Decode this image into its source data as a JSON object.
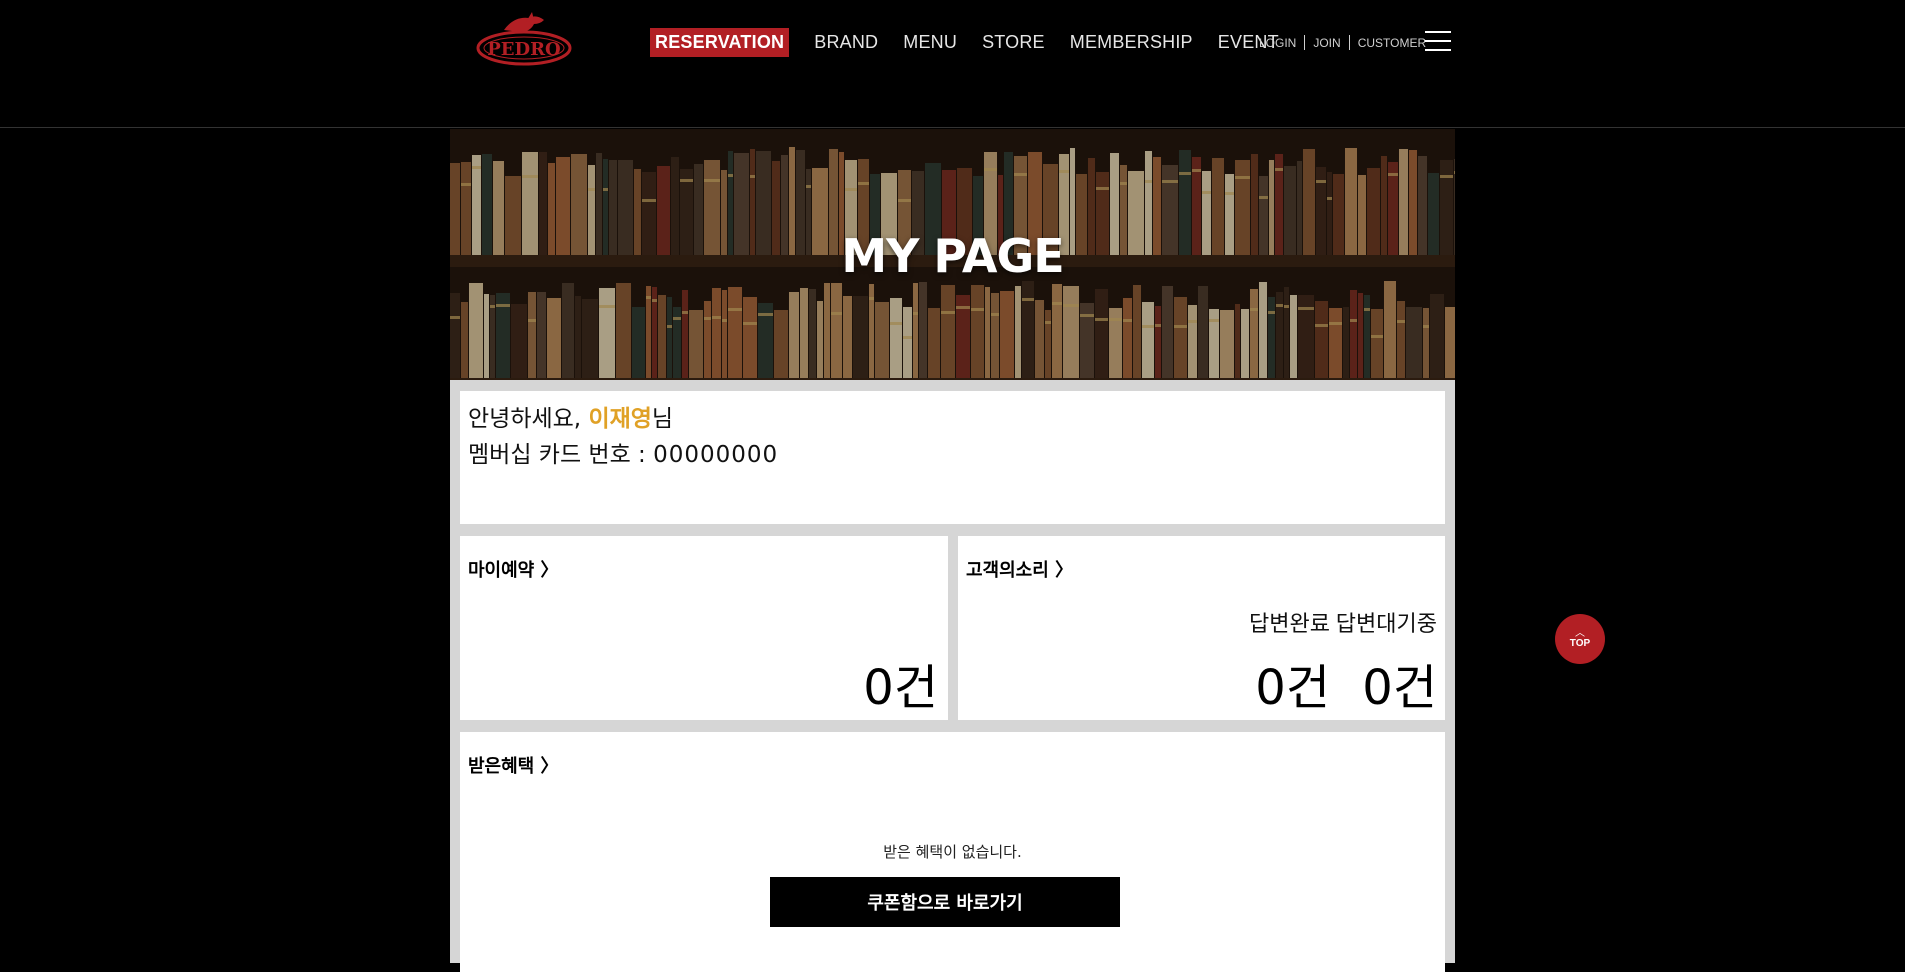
{
  "header": {
    "logo_text": "PEDRO",
    "nav": [
      {
        "label": "RESERVATION",
        "active": true
      },
      {
        "label": "BRAND",
        "active": false
      },
      {
        "label": "MENU",
        "active": false
      },
      {
        "label": "STORE",
        "active": false
      },
      {
        "label": "MEMBERSHIP",
        "active": false
      },
      {
        "label": "EVENT",
        "active": false
      }
    ],
    "util": {
      "login": "LOGIN",
      "join": "JOIN",
      "customer": "CUSTOMER"
    },
    "menu_icon": "hamburger-menu-icon",
    "accent_color": "#b21f24"
  },
  "banner": {
    "title": "MY PAGE"
  },
  "greeting": {
    "hello": "안녕하세요, ",
    "name": "이재영",
    "suffix": "님",
    "card_label": "멤버십 카드 번호 : ",
    "card_number": "00000000"
  },
  "reservation": {
    "title": "마이예약 〉",
    "count": "0건"
  },
  "voice": {
    "title": "고객의소리 〉",
    "answered_label": "답변완료",
    "answered_count": "0건",
    "waiting_label": "답변대기중",
    "waiting_count": "0건"
  },
  "benefit": {
    "title": "받은혜택 〉",
    "empty_message": "받은 혜택이 없습니다.",
    "coupon_button": "쿠폰함으로 바로가기"
  },
  "top_button": {
    "label": "TOP",
    "icon": "chevron-up-icon"
  }
}
